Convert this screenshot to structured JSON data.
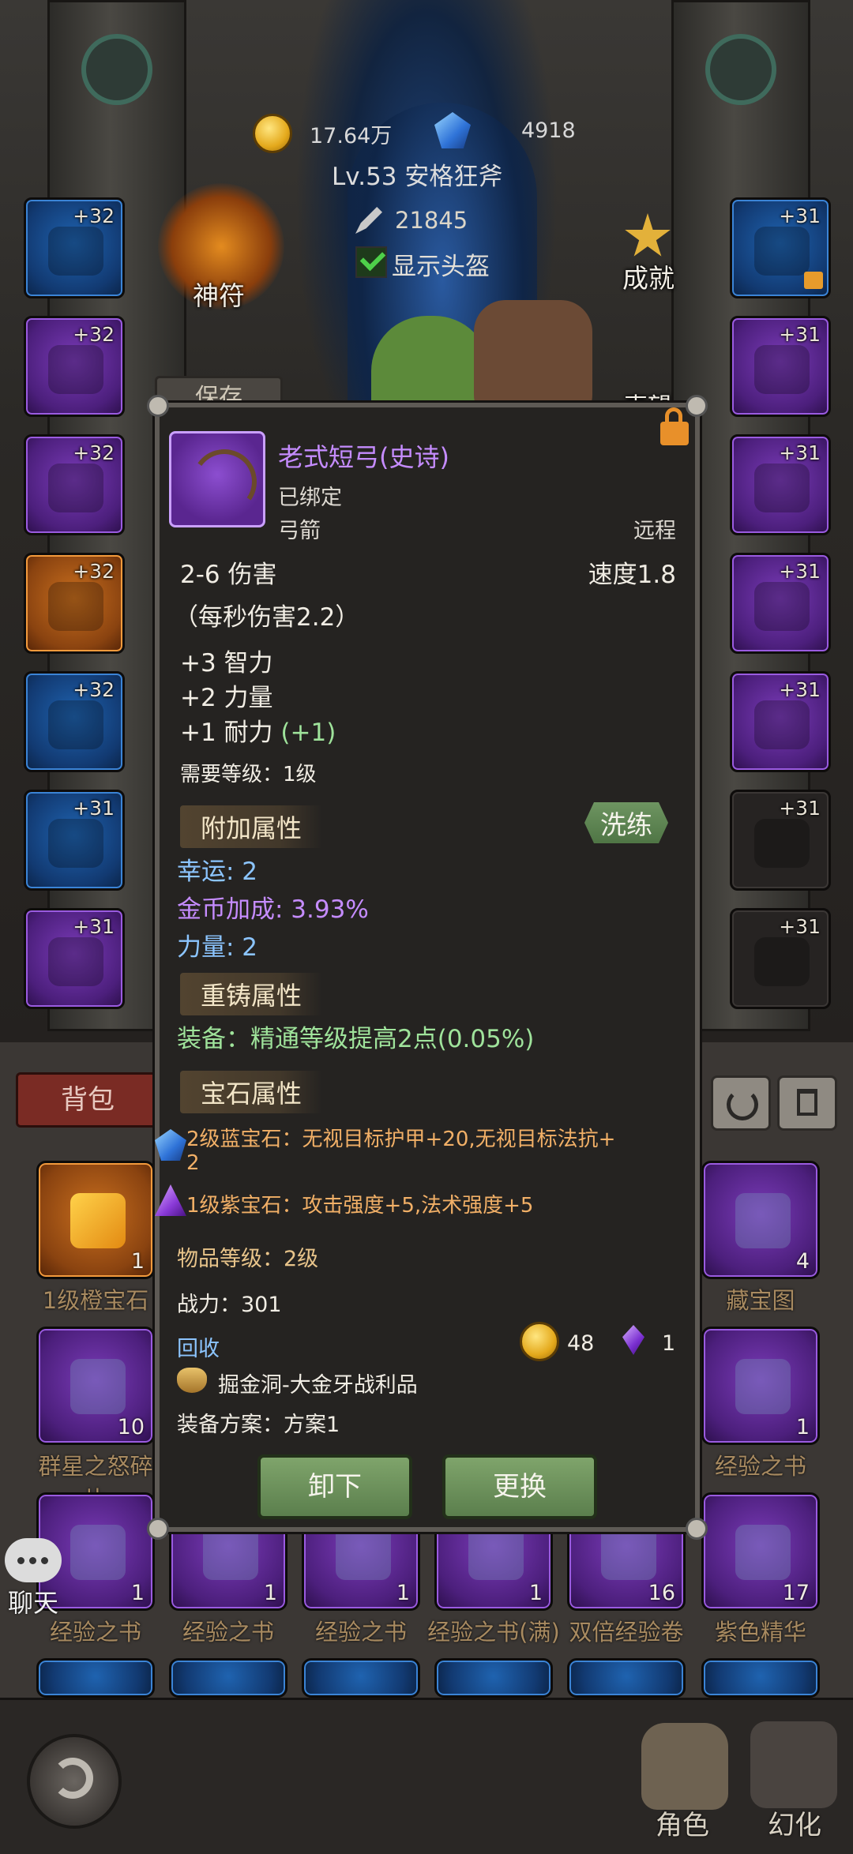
{
  "top": {
    "gold": "17.64万",
    "gems": "4918",
    "char_title": "Lv.53 安格狂斧",
    "power": "21845",
    "show_helmet": "显示头盔",
    "rune_label": "神符",
    "achievement_label": "成就",
    "partial_right_label": "声望",
    "partial_left_label": "保存"
  },
  "left_slots": [
    {
      "level": "+32",
      "quality": "blue"
    },
    {
      "level": "+32",
      "quality": "purple"
    },
    {
      "level": "+32",
      "quality": "purple"
    },
    {
      "level": "+32",
      "quality": "orange"
    },
    {
      "level": "+32",
      "quality": "blue"
    },
    {
      "level": "+31",
      "quality": "blue"
    },
    {
      "level": "+31",
      "quality": "purple"
    }
  ],
  "right_slots": [
    {
      "level": "+31",
      "quality": "blue"
    },
    {
      "level": "+31",
      "quality": "purple"
    },
    {
      "level": "+31",
      "quality": "purple"
    },
    {
      "level": "+31",
      "quality": "purple"
    },
    {
      "level": "+31",
      "quality": "purple"
    },
    {
      "level": "+31",
      "quality": "empty"
    },
    {
      "level": "+31",
      "quality": "empty"
    }
  ],
  "bag": {
    "tab_label": "背包",
    "items": [
      {
        "name": "1级橙宝石",
        "count": "1"
      },
      {
        "name": "藏宝图",
        "count": "4"
      },
      {
        "name": "群星之怒碎片",
        "count": "10"
      },
      {
        "name": "经验之书",
        "count": "1"
      },
      {
        "name": "经验之书",
        "count": "1"
      },
      {
        "name": "经验之书",
        "count": "1"
      },
      {
        "name": "经验之书",
        "count": "1"
      },
      {
        "name": "经验之书(满)",
        "count": "1"
      },
      {
        "name": "双倍经验卷",
        "count": "16"
      },
      {
        "name": "紫色精华",
        "count": "17"
      }
    ]
  },
  "chat_label": "聊天",
  "nav": {
    "role": "角色",
    "illusion": "幻化"
  },
  "item": {
    "name": "老式短弓(史诗)",
    "bound": "已绑定",
    "type": "弓箭",
    "range": "远程",
    "damage": "2-6 伤害",
    "speed": "速度1.8",
    "dps": "（每秒伤害2.2）",
    "stat1": "+3 智力",
    "stat2": "+2 力量",
    "stat3": "+1 耐力",
    "stat3_bonus": "(+1)",
    "req_level": "需要等级：1级",
    "extra_title": "附加属性",
    "refine_label": "洗练",
    "extra1": "幸运: 2",
    "extra2": "金币加成: 3.93%",
    "extra3": "力量: 2",
    "reforge_title": "重铸属性",
    "reforge1": "装备：精通等级提高2点(0.05%)",
    "gem_title": "宝石属性",
    "gem1_line1": "2级蓝宝石：无视目标护甲+20,无视目标法抗+",
    "gem1_line2": "2",
    "gem2": "1级紫宝石：攻击强度+5,法术强度+5",
    "item_level": "物品等级：2级",
    "battle_power": "战力：301",
    "recycle": "回收",
    "recycle_gold": "48",
    "recycle_essence": "1",
    "source": "掘金洞-大金牙战利品",
    "equip_plan": "装备方案：方案1",
    "unequip": "卸下",
    "replace": "更换"
  },
  "colors": {
    "epic_purple": "#c58cff",
    "magic_blue": "#8cc5ff",
    "green": "#9fe39b",
    "gem_orange": "#f2b067"
  }
}
